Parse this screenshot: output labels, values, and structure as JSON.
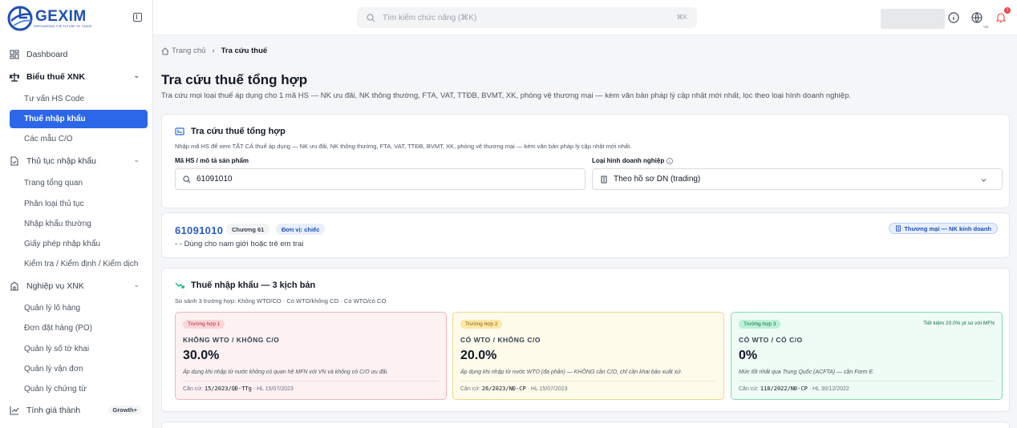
{
  "brand": {
    "name": "GEXIM",
    "tagline": "EMPOWERING THE FUTURE OF TRADE",
    "accent": "#2b67e8"
  },
  "sidebar": {
    "items": [
      {
        "label": "Dashboard",
        "icon": "dashboard-icon"
      },
      {
        "label": "Biểu thuế XNK",
        "icon": "scale-icon",
        "expanded": true,
        "children": [
          "Tư vấn HS Code",
          "Thuế nhập khẩu",
          "Các mẫu C/O"
        ]
      },
      {
        "label": "Thủ tục nhập khẩu",
        "icon": "document-icon",
        "expanded": true,
        "children": [
          "Trang tổng quan",
          "Phân loại thủ tục",
          "Nhập khẩu thường",
          "Giấy phép nhập khẩu",
          "Kiểm tra / Kiểm định / Kiểm dịch"
        ]
      },
      {
        "label": "Nghiệp vụ XNK",
        "icon": "building-icon",
        "expanded": true,
        "children": [
          "Quản lý lô hàng",
          "Đơn đặt hàng (PO)",
          "Quản lý số tờ khai",
          "Quản lý vận đơn",
          "Quản lý chứng từ"
        ]
      },
      {
        "label": "Tính giá thành",
        "icon": "chart-icon",
        "badge": "Growth+"
      }
    ],
    "active": "Thuế nhập khẩu"
  },
  "topbar": {
    "search_placeholder": "Tìm kiếm chức năng (⌘K)",
    "shortcut": "⌘K",
    "lang": "VN",
    "notifications": "1"
  },
  "breadcrumb": {
    "home": "Trang chủ",
    "current": "Tra cứu thuế"
  },
  "page": {
    "title": "Tra cứu thuế tổng hợp",
    "description": "Tra cứu mọi loại thuế áp dụng cho 1 mã HS — NK ưu đãi, NK thông thường, FTA, VAT, TTĐB, BVMT, XK, phòng vệ thương mại — kèm văn bản pháp lý cập nhật mới nhất, lọc theo loại hình doanh nghiệp."
  },
  "lookup": {
    "title": "Tra cứu thuế tổng hợp",
    "subtitle": "Nhập mã HS để xem TẤT CẢ thuế áp dụng — NK ưu đãi, NK thông thường, FTA, VAT, TTĐB, BVMT, XK, phòng vệ thương mại — kèm văn bản pháp lý cập nhật mới nhất.",
    "hs_label": "Mã HS / mô tả sản phẩm",
    "hs_value": "61091010",
    "biz_label": "Loại hình doanh nghiệp",
    "biz_value": "Theo hồ sơ DN (trading)"
  },
  "product": {
    "code": "61091010",
    "chapter": "Chương 61",
    "unit": "Đơn vị: chiếc",
    "type_badge": "Thương mại — NK kinh doanh",
    "description": "- - Dùng cho nam giới hoặc trẻ em trai"
  },
  "import_tax": {
    "title": "Thuế nhập khẩu — 3 kịch bản",
    "subtitle": "So sánh 3 trường hợp: Không WTO/CO · Có WTO/không CO · Có WTO/có CO",
    "scenarios": [
      {
        "tag": "Trường hợp 1",
        "heading": "KHÔNG WTO / KHÔNG C/O",
        "rate": "30.0%",
        "note": "Áp dụng khi nhập từ nước không có quan hệ MFN với VN và không có C/O ưu đãi.",
        "basis_label": "Căn cứ:",
        "basis_doc": "15/2023/QĐ-TTg",
        "basis_date": "· HL 15/07/2023",
        "color": "#f3b4bc"
      },
      {
        "tag": "Trường hợp 2",
        "heading": "CÓ WTO / KHÔNG C/O",
        "rate": "20.0%",
        "note": "Áp dụng khi nhập từ nước WTO (đa phần) — KHÔNG cần C/O, chỉ cần khai báo xuất xứ.",
        "basis_label": "Căn cứ:",
        "basis_doc": "26/2023/NĐ-CP",
        "basis_date": "· HL 15/07/2023",
        "color": "#f1d68a"
      },
      {
        "tag": "Trường hợp 3",
        "heading": "CÓ WTO / CÓ C/O",
        "rate": "0%",
        "note": "Mức tốt nhất qua Trung Quốc (ACFTA) — cần Form E.",
        "basis_label": "Căn cứ:",
        "basis_doc": "118/2022/NĐ-CP",
        "basis_date": "· HL 30/12/2022",
        "saving": "Tiết kiệm 20.0% pt so với MFN",
        "color": "#7fdcaf"
      }
    ]
  }
}
